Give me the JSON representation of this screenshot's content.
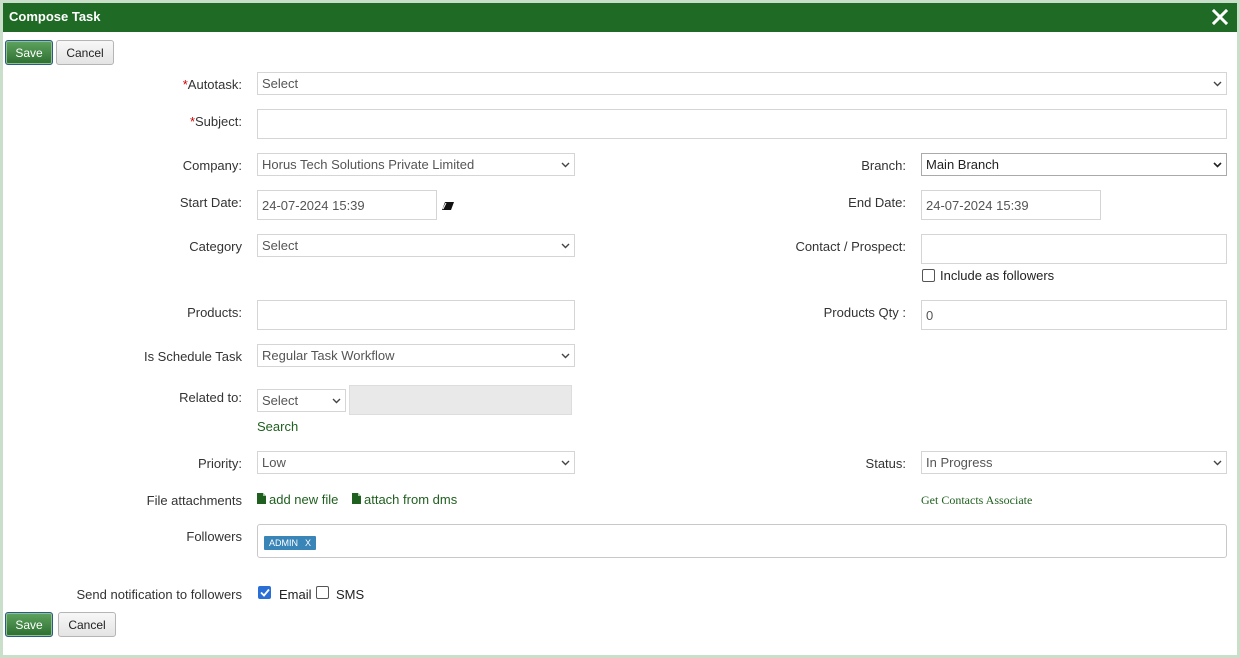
{
  "dialog": {
    "title": "Compose Task"
  },
  "toolbar": {
    "save_label": "Save",
    "cancel_label": "Cancel"
  },
  "form": {
    "autotask": {
      "label": "Autotask:",
      "value": "Select"
    },
    "subject": {
      "label": "Subject:",
      "value": ""
    },
    "company": {
      "label": "Company:",
      "value": "Horus Tech Solutions Private Limited"
    },
    "branch": {
      "label": "Branch:",
      "value": "Main Branch"
    },
    "start_date": {
      "label": "Start Date:",
      "value": "24-07-2024 15:39"
    },
    "end_date": {
      "label": "End Date:",
      "value": "24-07-2024 15:39"
    },
    "category": {
      "label": "Category",
      "value": "Select"
    },
    "contact": {
      "label": "Contact / Prospect:",
      "value": ""
    },
    "include_followers": {
      "label": "Include as followers",
      "checked": false
    },
    "products": {
      "label": "Products:",
      "value": ""
    },
    "products_qty": {
      "label": "Products Qty :",
      "value": "0"
    },
    "schedule": {
      "label": "Is Schedule Task",
      "value": "Regular Task Workflow"
    },
    "related": {
      "label": "Related to:",
      "value": "Select",
      "search_label": "Search"
    },
    "priority": {
      "label": "Priority:",
      "value": "Low"
    },
    "status": {
      "label": "Status:",
      "value": "In Progress"
    },
    "attachments": {
      "label": "File attachments",
      "add_new": "add new file",
      "from_dms": "attach from dms"
    },
    "contacts_associate": "Get Contacts Associate",
    "followers": {
      "label": "Followers",
      "tags": [
        "ADMIN"
      ],
      "remove": "X"
    },
    "notify": {
      "label": "Send notification to followers",
      "email_label": "Email",
      "email_checked": true,
      "sms_label": "SMS",
      "sms_checked": false
    }
  }
}
